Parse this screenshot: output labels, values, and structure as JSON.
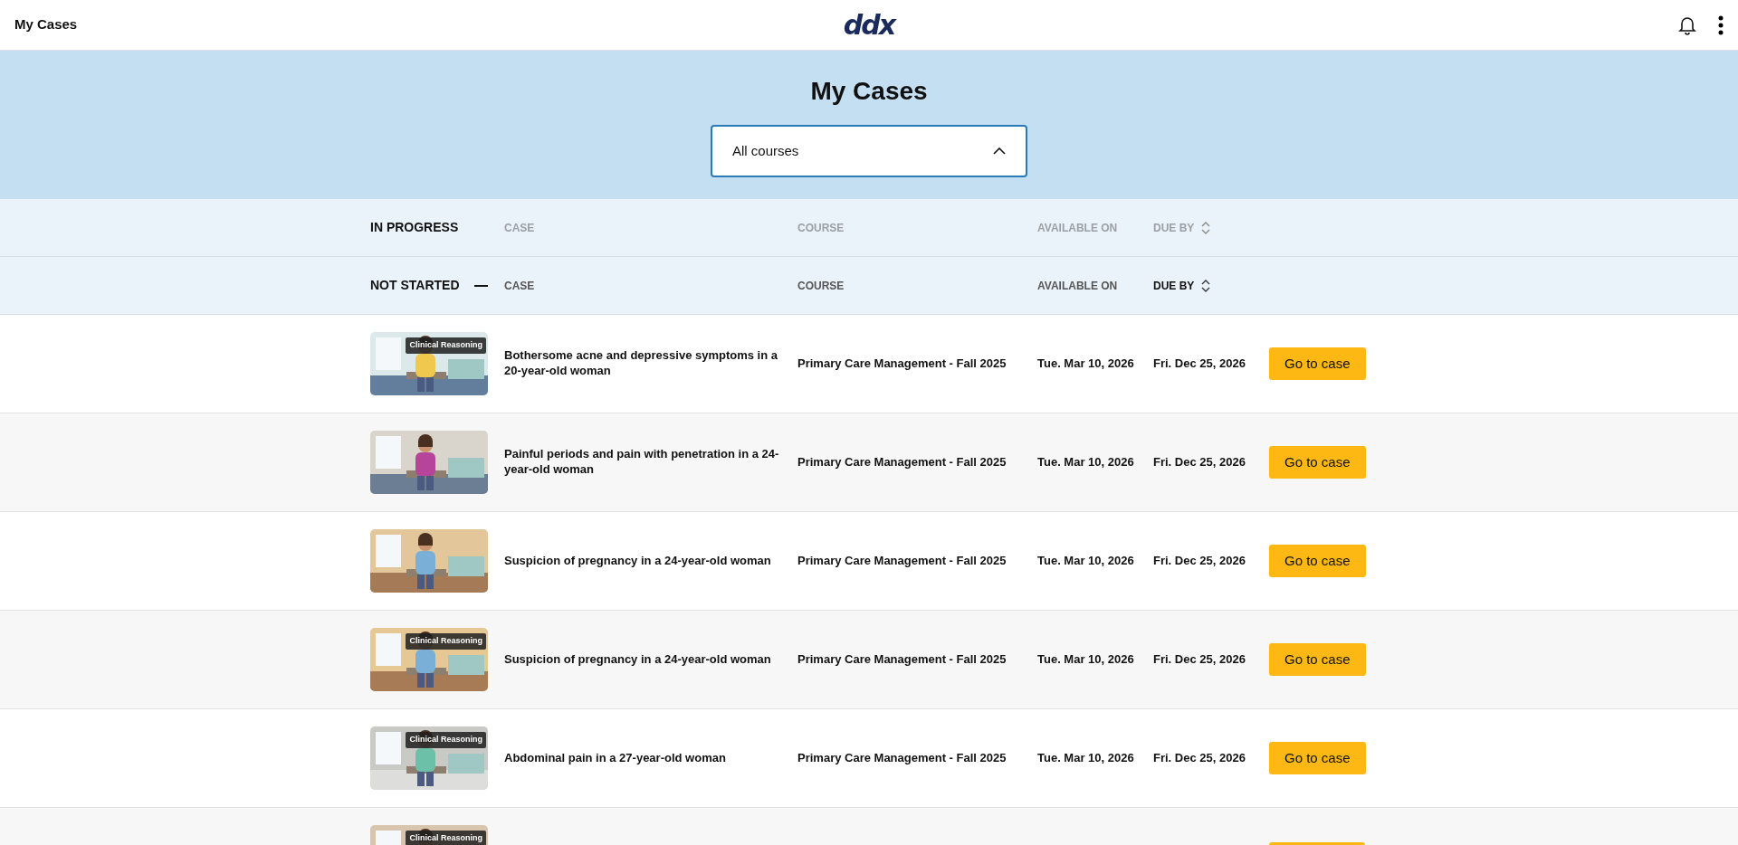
{
  "topbar": {
    "title": "My Cases",
    "logo": "ddx"
  },
  "hero": {
    "title": "My Cases",
    "select": {
      "value": "All courses",
      "expanded": true
    }
  },
  "sections": [
    {
      "label": "IN PROGRESS",
      "expanded": false,
      "columns": [
        {
          "label": "CASE"
        },
        {
          "label": "COURSE"
        },
        {
          "label": "AVAILABLE ON"
        },
        {
          "label": "DUE BY",
          "sorted": false
        }
      ]
    },
    {
      "label": "NOT STARTED",
      "expanded": true,
      "columns": [
        {
          "label": "CASE"
        },
        {
          "label": "COURSE"
        },
        {
          "label": "AVAILABLE ON"
        },
        {
          "label": "DUE BY",
          "sorted": true
        }
      ]
    }
  ],
  "rows": [
    {
      "badge": "Clinical Reasoning",
      "case": "Bothersome acne and depressive symptoms in a 20-year-old woman",
      "course": "Primary Care Management - Fall 2025",
      "available_on": "Tue. Mar 10, 2026",
      "due_by": "Fri. Dec 25, 2026",
      "button": "Go to case"
    },
    {
      "case": "Painful periods and pain with penetration in a 24-year-old woman",
      "course": "Primary Care Management - Fall 2025",
      "available_on": "Tue. Mar 10, 2026",
      "due_by": "Fri. Dec 25, 2026",
      "button": "Go to case"
    },
    {
      "case": "Suspicion of pregnancy in a 24-year-old woman",
      "course": "Primary Care Management - Fall 2025",
      "available_on": "Tue. Mar 10, 2026",
      "due_by": "Fri. Dec 25, 2026",
      "button": "Go to case"
    },
    {
      "badge": "Clinical Reasoning",
      "case": "Suspicion of pregnancy in a 24-year-old woman",
      "course": "Primary Care Management - Fall 2025",
      "available_on": "Tue. Mar 10, 2026",
      "due_by": "Fri. Dec 25, 2026",
      "button": "Go to case"
    },
    {
      "badge": "Clinical Reasoning",
      "case": "Abdominal pain in a 27-year-old woman",
      "course": "Primary Care Management - Fall 2025",
      "available_on": "Tue. Mar 10, 2026",
      "due_by": "Fri. Dec 25, 2026",
      "button": "Go to case"
    },
    {
      "badge": "Clinical Reasoning"
    }
  ]
}
